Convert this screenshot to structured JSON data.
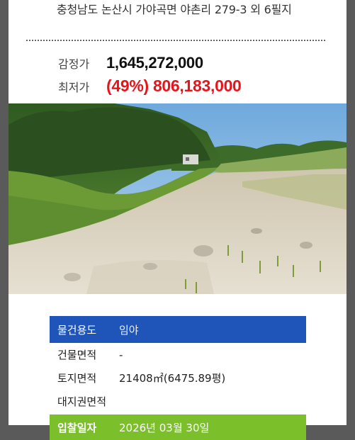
{
  "property": {
    "address": "충청남도 논산시 가야곡면 야촌리 279-3 외 6필지"
  },
  "prices": {
    "appraisal_label": "감정가",
    "appraisal_value": "1,645,272,000",
    "minimum_label": "최저가",
    "minimum_value": "(49%) 806,183,000"
  },
  "photo": {
    "icon": "land-photo"
  },
  "details": {
    "usage_label": "물건용도",
    "usage_value": "임야",
    "building_area_label": "건물면적",
    "building_area_value": "-",
    "land_area_label": "토지면적",
    "land_area_value": "21408㎡(6475.89평)",
    "land_right_area_label": "대지권면적",
    "land_right_area_value": "",
    "date_label": "입찰일자",
    "date_value": "2026년 03월 30일"
  },
  "colors": {
    "usage_bar": "#1f55b8",
    "date_bar": "#7bbf2a",
    "minimum_price": "#e8141b",
    "page_background": "#5a5a5a"
  }
}
